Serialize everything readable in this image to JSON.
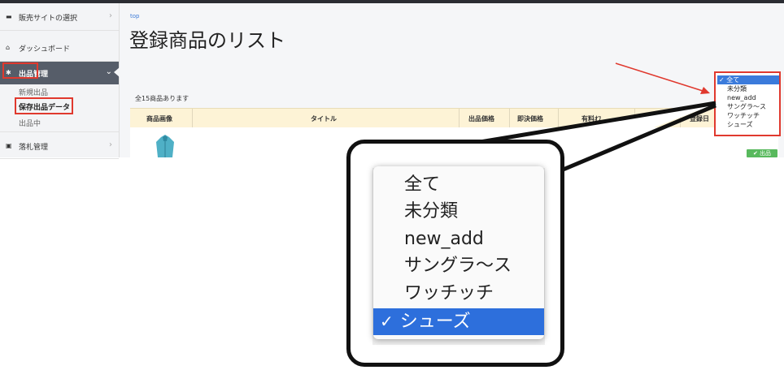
{
  "sidebar": {
    "items": [
      {
        "icon": "folder-icon",
        "label": "販売サイトの選択"
      },
      {
        "icon": "home-icon",
        "label": "ダッシュボード"
      },
      {
        "icon": "star-icon",
        "label": "出品管理"
      },
      {
        "icon": "gavel-icon",
        "label": "落札管理"
      }
    ],
    "subitems": [
      "新規出品",
      "保存出品データ",
      "出品中"
    ]
  },
  "main": {
    "breadcrumb": "top",
    "title": "登録商品のリスト",
    "count_text": "全15商品あります",
    "columns": [
      "商品画像",
      "タイトル",
      "出品価格",
      "即決価格",
      "有料ｵﾌ",
      "登録日"
    ],
    "badge_label": "✔ 出品"
  },
  "filter_dropdown": {
    "options": [
      "全て",
      "未分類",
      "new_add",
      "サングラ〜ス",
      "ワッチッチ",
      "シューズ"
    ],
    "selected": "全て"
  },
  "zoom_dropdown": {
    "options": [
      "全て",
      "未分類",
      "new_add",
      "サングラ〜ス",
      "ワッチッチ",
      "シューズ"
    ],
    "selected": "シューズ",
    "check": "✓"
  },
  "colors": {
    "highlight": "#e0392e",
    "selection": "#2d6fdc",
    "sidebar_active": "#565d69",
    "table_header": "#fdf3d6"
  }
}
